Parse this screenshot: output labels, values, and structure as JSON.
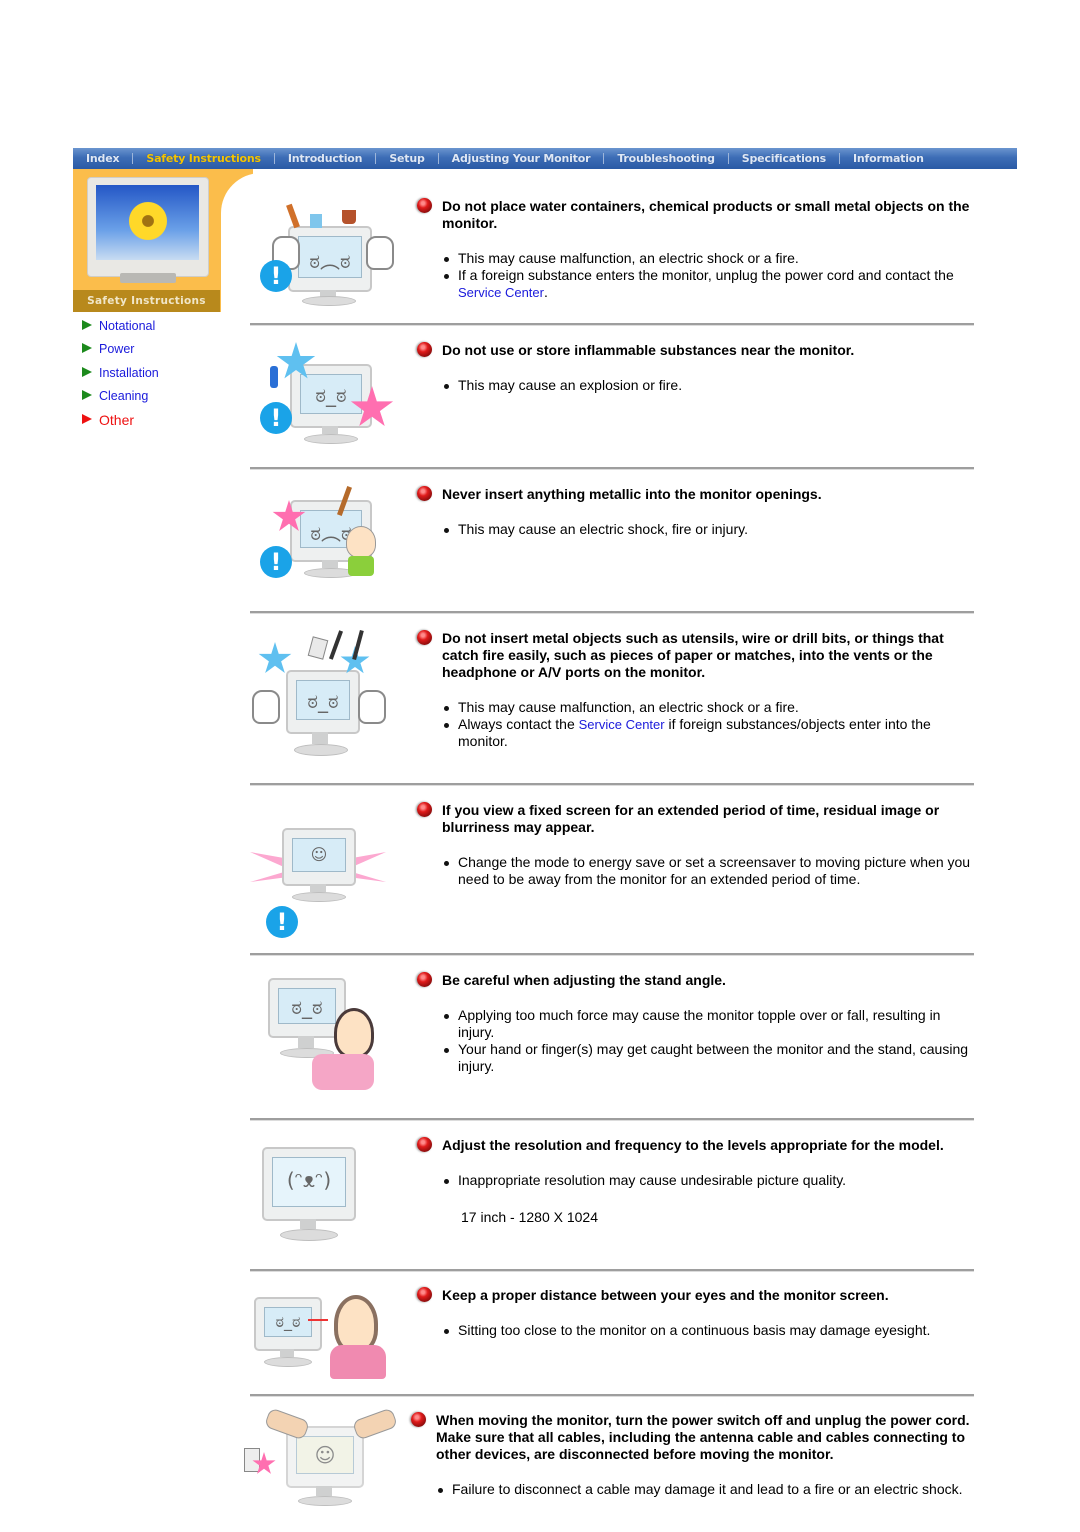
{
  "nav": {
    "items": [
      {
        "label": "Index",
        "active": false
      },
      {
        "label": "Safety Instructions",
        "active": true
      },
      {
        "label": "Introduction",
        "active": false
      },
      {
        "label": "Setup",
        "active": false
      },
      {
        "label": "Adjusting Your Monitor",
        "active": false
      },
      {
        "label": "Troubleshooting",
        "active": false
      },
      {
        "label": "Specifications",
        "active": false
      },
      {
        "label": "Information",
        "active": false
      }
    ],
    "active_color": "#f5c400",
    "bar_color": "#3d6db6"
  },
  "sidebar": {
    "banner_label": "Safety Instructions",
    "banner_color": "#fbbd4b",
    "items": [
      {
        "label": "Notational",
        "current": false
      },
      {
        "label": "Power",
        "current": false
      },
      {
        "label": "Installation",
        "current": false
      },
      {
        "label": "Cleaning",
        "current": false
      },
      {
        "label": "Other",
        "current": true
      }
    ],
    "link_color": "#1a1adb",
    "current_color": "#ee1111"
  },
  "sections": [
    {
      "heading": "Do not place water containers, chemical products or small metal objects on the monitor.",
      "illustration": "monitor-with-objects-on-top",
      "points": [
        {
          "text": "This may cause malfunction, an electric shock or a fire."
        },
        {
          "before": "If a foreign substance enters the monitor, unplug the power cord and contact the ",
          "link": "Service Center",
          "after": "."
        }
      ]
    },
    {
      "heading": "Do not use or store inflammable substances near the monitor.",
      "illustration": "monitor-with-explosion",
      "points": [
        {
          "text": "This may cause an explosion or fire."
        }
      ]
    },
    {
      "heading": "Never insert anything metallic into the monitor openings.",
      "illustration": "child-inserting-metal",
      "points": [
        {
          "text": "This may cause an electric shock, fire or injury."
        }
      ]
    },
    {
      "heading": "Do not insert metal objects such as utensils, wire or drill bits, or things that catch fire easily, such as pieces of paper or matches, into the vents or the headphone or A/V ports on the monitor.",
      "illustration": "monitor-with-sparks",
      "points": [
        {
          "text": "This may cause malfunction, an electric shock or a fire."
        },
        {
          "before": "Always contact the ",
          "link": "Service Center",
          "after": " if foreign substances/objects enter into the monitor."
        }
      ]
    },
    {
      "heading": "If you view a fixed screen for an extended period of time, residual image or blurriness may appear.",
      "illustration": "monitor-residual-image",
      "points": [
        {
          "text": "Change the mode to energy save or set a screensaver to moving picture when you need to be away from the monitor for an extended period of time."
        }
      ]
    },
    {
      "heading": "Be careful when adjusting the stand angle.",
      "illustration": "person-adjusting-stand",
      "points": [
        {
          "text": "Applying too much force may cause the monitor topple over or fall, resulting in injury."
        },
        {
          "text": "Your hand or finger(s) may get caught between the monitor and the stand, causing injury."
        }
      ]
    },
    {
      "heading": "Adjust the resolution and frequency to the levels appropriate for the model.",
      "illustration": "monitor-low-quality",
      "points": [
        {
          "text": "Inappropriate resolution may cause undesirable picture quality."
        }
      ],
      "note": "17 inch - 1280 X 1024"
    },
    {
      "heading": "Keep a proper distance between your eyes and the monitor screen.",
      "illustration": "person-too-close",
      "points": [
        {
          "text": "Sitting too close to the monitor on a continuous basis may damage eyesight."
        }
      ]
    },
    {
      "heading": "When moving the monitor, turn the power switch off and unplug the power cord. Make sure that all cables, including the antenna cable and cables connecting to other devices, are disconnected before moving the monitor.",
      "illustration": "monitor-being-unplugged",
      "points": [
        {
          "text": "Failure to disconnect a cable may damage it and lead to a fire or an electric shock."
        }
      ]
    }
  ]
}
